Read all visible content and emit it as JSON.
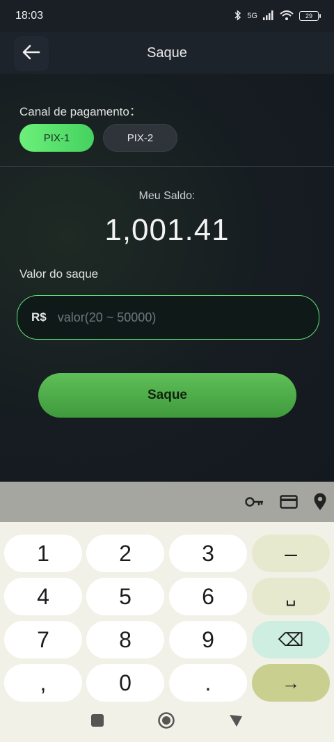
{
  "status_bar": {
    "time": "18:03",
    "network": "5G",
    "battery": "29",
    "icons": [
      "bluetooth-icon",
      "signal-icon",
      "wifi-icon",
      "battery-icon"
    ]
  },
  "header": {
    "title": "Saque",
    "back_icon": "arrow-left-icon"
  },
  "channel": {
    "label": "Canal de pagamento：",
    "options": [
      {
        "label": "PIX-1",
        "selected": true
      },
      {
        "label": "PIX-2",
        "selected": false
      }
    ]
  },
  "balance": {
    "label": "Meu Saldo:",
    "value": "1,001.41"
  },
  "amount": {
    "label": "Valor do saque",
    "currency": "R$",
    "value": "",
    "placeholder": "valor(20 ~ 50000)"
  },
  "submit_label": "Saque",
  "keyboard_toolbar": {
    "icons": [
      "key-icon",
      "credit-card-icon",
      "location-pin-icon"
    ]
  },
  "keyboard": {
    "rows": [
      [
        "1",
        "2",
        "3",
        "–"
      ],
      [
        "4",
        "5",
        "6",
        "␣"
      ],
      [
        "7",
        "8",
        "9",
        "⌫"
      ],
      [
        ",",
        "0",
        ".",
        "→"
      ]
    ]
  },
  "nav_bar": {
    "icons": [
      "recents-square-icon",
      "home-circle-icon",
      "back-triangle-icon"
    ]
  },
  "colors": {
    "accent_green": "#5ee07a",
    "button_green": "#4fae4a",
    "background": "#14191f"
  }
}
